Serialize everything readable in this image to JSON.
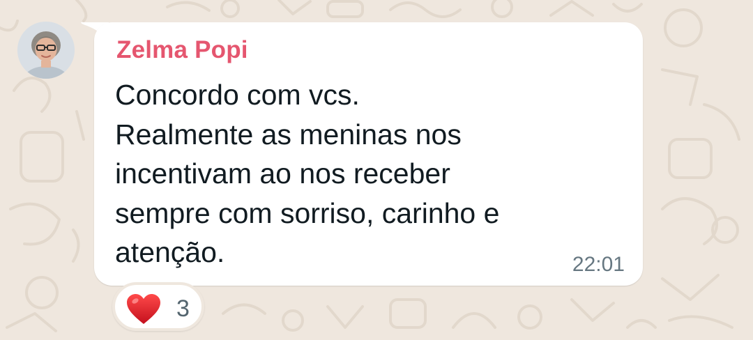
{
  "chat": {
    "background_color": "#efe7de",
    "message": {
      "sender_name": "Zelma Popi",
      "sender_name_color": "#e5566f",
      "lines": [
        "Concordo com vcs.",
        "Realmente as meninas nos",
        "incentivam ao nos receber",
        "sempre com sorriso, carinho e",
        "atenção."
      ],
      "time": "22:01",
      "avatar_icon": "profile-photo-avatar"
    },
    "reaction": {
      "emoji_icon": "red-heart-icon",
      "count": "3"
    }
  }
}
